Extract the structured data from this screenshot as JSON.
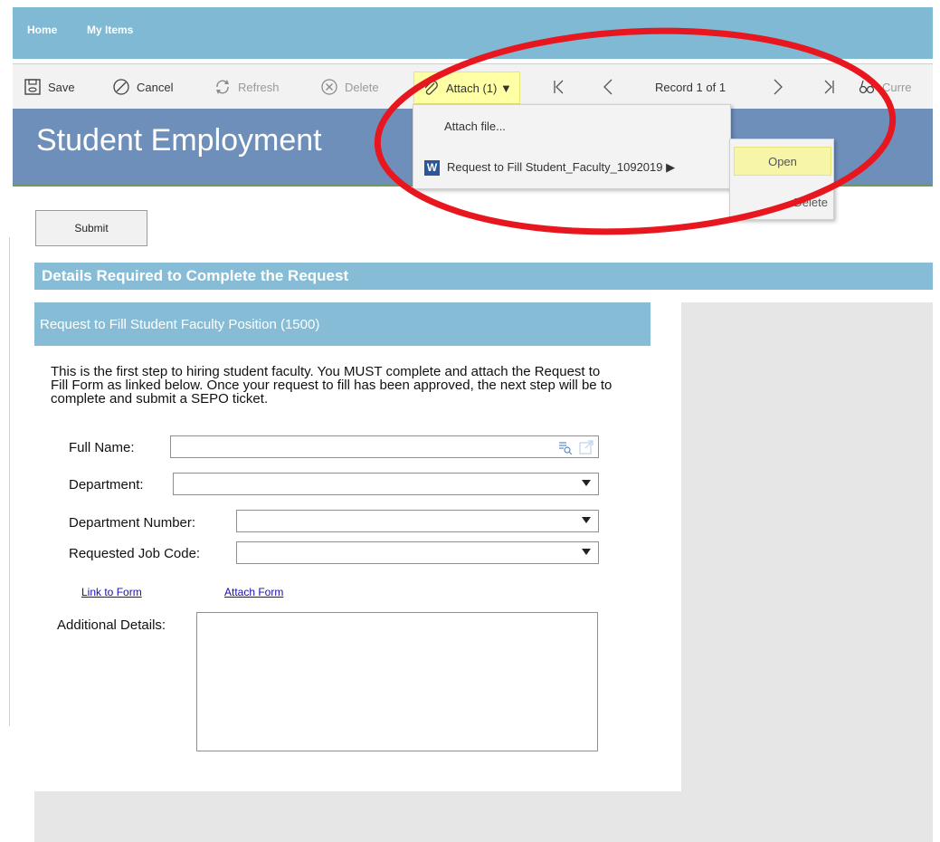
{
  "nav": {
    "home": "Home",
    "my_items": "My Items"
  },
  "toolbar": {
    "save": "Save",
    "cancel": "Cancel",
    "refresh": "Refresh",
    "delete": "Delete",
    "attach": "Attach (1) ▼",
    "record": "Record 1 of 1",
    "current": "Curre"
  },
  "banner": {
    "title": "Student Employment"
  },
  "submit_label": "Submit",
  "section_header": "Details Required to Complete the Request",
  "form": {
    "header": "Request to Fill Student Faculty Position (1500)",
    "intro": "This is the first step to hiring student faculty. You MUST complete and attach the Request to Fill Form as linked below. Once your request to fill has been approved, the next step will be to complete and submit a SEPO ticket.",
    "full_name_label": "Full Name:",
    "department_label": "Department:",
    "department_number_label": "Department Number:",
    "job_code_label": "Requested Job Code:",
    "link_to_form": "Link to Form",
    "attach_form": "Attach Form",
    "additional_details_label": "Additional Details:"
  },
  "attach_menu": {
    "attach_file": "Attach file...",
    "file_name": "Request to Fill Student_Faculty_1092019 ▶",
    "file_icon_letter": "W"
  },
  "submenu": {
    "open": "Open",
    "delete": "Delete"
  },
  "colors": {
    "nav_bg": "#7fb9d3",
    "banner_bg": "#6f8fbb",
    "section_bg": "#87bcd6",
    "highlight": "#ffffa6",
    "annotation": "#e8161e"
  }
}
